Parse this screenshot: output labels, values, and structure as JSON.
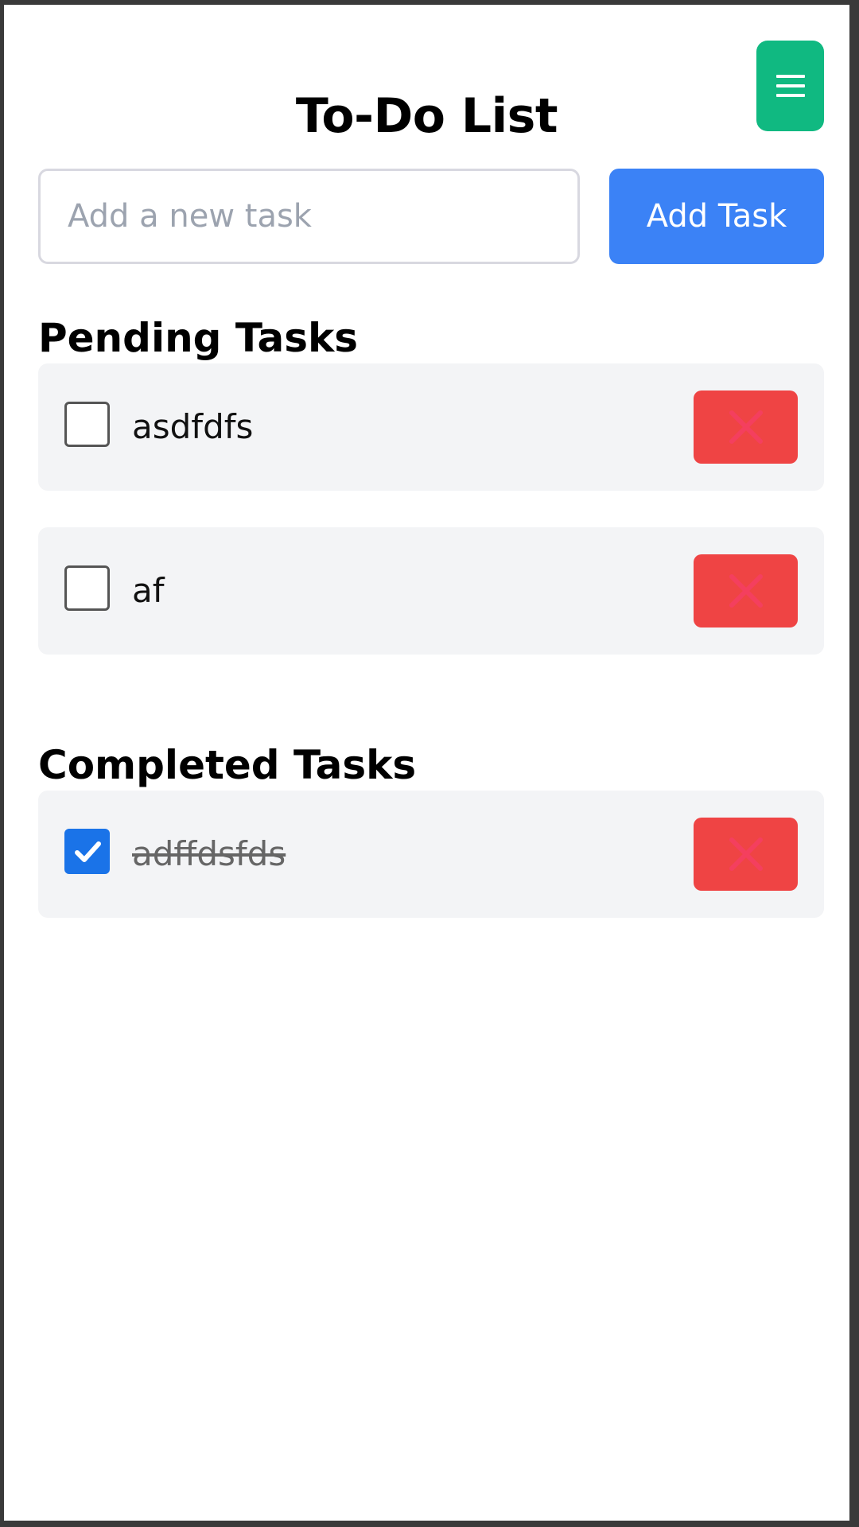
{
  "header": {
    "title": "To-Do List",
    "menu_icon": "hamburger-icon",
    "menu_color": "#10b981"
  },
  "add_task": {
    "input_value": "",
    "placeholder": "Add a new task",
    "button_label": "Add Task",
    "button_color": "#3b82f6"
  },
  "pending": {
    "heading": "Pending Tasks",
    "items": [
      {
        "text": "asdfdfs",
        "checked": false
      },
      {
        "text": "af",
        "checked": false
      }
    ]
  },
  "completed": {
    "heading": "Completed Tasks",
    "items": [
      {
        "text": "adffdsfds",
        "checked": true
      }
    ]
  },
  "icons": {
    "delete": "close-icon",
    "check": "checkmark-icon"
  },
  "colors": {
    "delete_button": "#ef4444",
    "delete_icon": "#f43f5e",
    "checkbox_checked": "#1a73e8",
    "task_background": "#f3f4f6"
  }
}
